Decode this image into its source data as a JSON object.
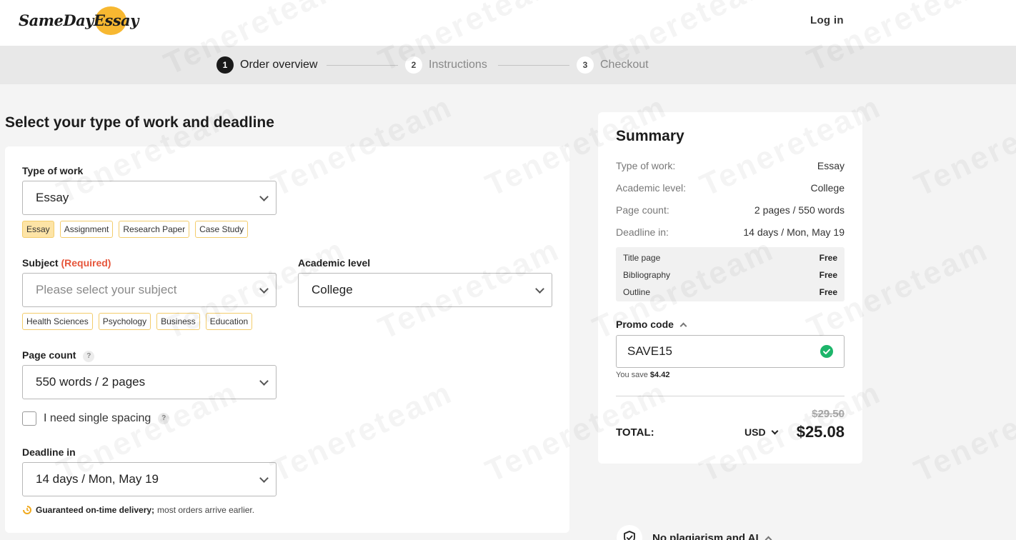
{
  "header": {
    "logo_text": "SameDayEssay",
    "login_label": "Log in"
  },
  "steps": [
    {
      "num": "1",
      "label": "Order overview",
      "active": true
    },
    {
      "num": "2",
      "label": "Instructions",
      "active": false
    },
    {
      "num": "3",
      "label": "Checkout",
      "active": false
    }
  ],
  "page_title": "Select your type of work and deadline",
  "form": {
    "type_of_work": {
      "label": "Type of work",
      "value": "Essay",
      "chips": [
        "Essay",
        "Assignment",
        "Research Paper",
        "Case Study"
      ]
    },
    "subject": {
      "label": "Subject",
      "required_label": "(Required)",
      "placeholder": "Please select your subject",
      "chips": [
        "Health Sciences",
        "Psychology",
        "Business",
        "Education"
      ]
    },
    "academic_level": {
      "label": "Academic level",
      "value": "College"
    },
    "page_count": {
      "label": "Page count",
      "help": "?",
      "value": "550 words / 2 pages"
    },
    "single_spacing": {
      "label": "I need single spacing",
      "help": "?",
      "checked": false
    },
    "deadline": {
      "label": "Deadline in",
      "value": "14 days / Mon, May 19"
    },
    "guarantee": {
      "bold": "Guaranteed on-time delivery;",
      "rest": "most orders arrive earlier."
    }
  },
  "summary": {
    "title": "Summary",
    "rows": [
      {
        "k": "Type of work:",
        "v": "Essay"
      },
      {
        "k": "Academic level:",
        "v": "College"
      },
      {
        "k": "Page count:",
        "v": "2 pages / 550 words"
      },
      {
        "k": "Deadline in:",
        "v": "14 days / Mon, May 19"
      }
    ],
    "extras": [
      {
        "k": "Title page",
        "v": "Free"
      },
      {
        "k": "Bibliography",
        "v": "Free"
      },
      {
        "k": "Outline",
        "v": "Free"
      }
    ],
    "promo": {
      "label": "Promo code",
      "value": "SAVE15",
      "save_prefix": "You save",
      "save_amount": "$4.42"
    },
    "old_price": "$29.50",
    "total_label": "TOTAL:",
    "currency": "USD",
    "total": "$25.08"
  },
  "no_plagiarism": "No plagiarism and AI",
  "watermark": "Tenereteam",
  "colors": {
    "accent_yellow": "#f7b831",
    "chip_border": "#f3cc6b",
    "required_red": "#e6553a",
    "success_green": "#1db56a"
  }
}
